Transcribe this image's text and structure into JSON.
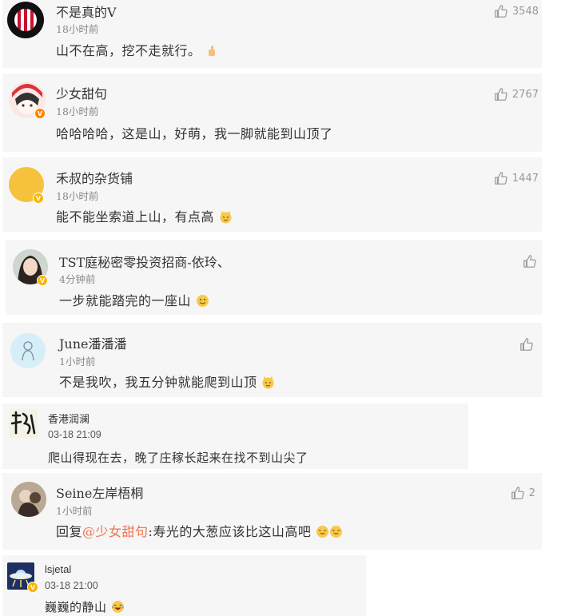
{
  "comments": [
    {
      "user": "不是真的V",
      "time": "18小时前",
      "text": "山不在高，挖不走就行。",
      "likes": "3548"
    },
    {
      "user": "少女甜句",
      "time": "18小时前",
      "text": "哈哈哈哈，这是山，好萌，我一脚就能到山顶了",
      "likes": "2767"
    },
    {
      "user": "禾叔的杂货铺",
      "time": "18小时前",
      "text": "能不能坐索道上山，有点高",
      "likes": "1447"
    },
    {
      "user": "TST庭秘密零投资招商-依玲、",
      "time": "4分钟前",
      "text": "一步就能踏完的一座山",
      "likes": ""
    },
    {
      "user": "June潘潘潘",
      "time": "1小时前",
      "text": "不是我吹，我五分钟就能爬到山顶",
      "likes": ""
    },
    {
      "user": "香港润澜",
      "time": "03-18 21:09",
      "text": "爬山得现在去，晚了庄稼长起来在找不到山尖了"
    },
    {
      "user": "Seine左岸梧桐",
      "time": "1小时前",
      "reply_prefix": "回复",
      "mention": "@少女甜句",
      "text": ":寿光的大葱应该比这山高吧",
      "likes": "2"
    },
    {
      "user": "lsjetal",
      "time": "03-18 21:00",
      "text": "巍巍的静山"
    }
  ],
  "icons": {
    "like": "thumbs-up-icon",
    "verified": "verified-badge-icon"
  },
  "colors": {
    "card_bg": "#f6f6f6",
    "verified_orange": "#ff8200",
    "verified_yellow": "#f9b400",
    "mention": "#eb7350"
  }
}
